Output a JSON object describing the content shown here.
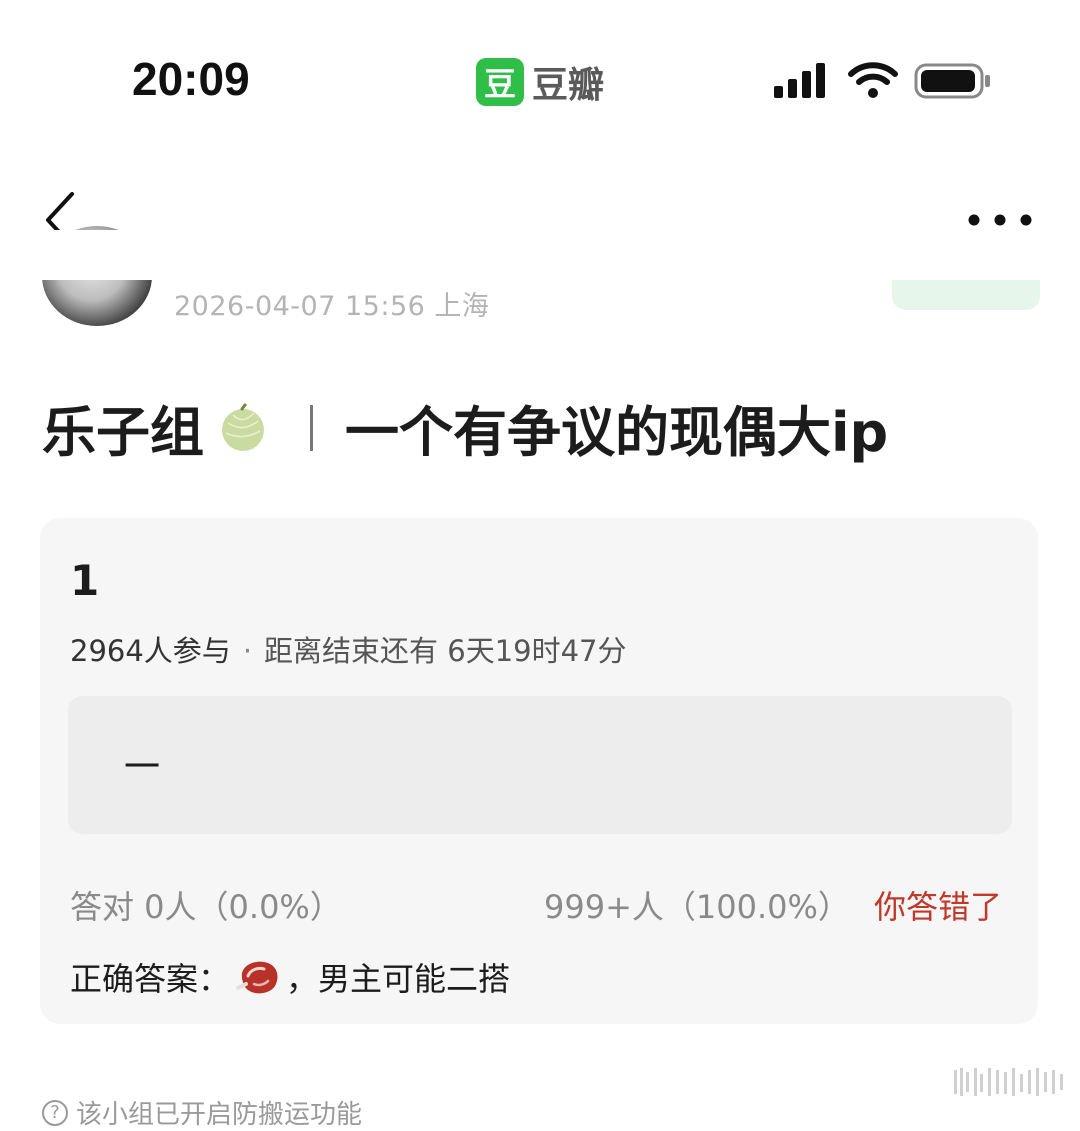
{
  "status_bar": {
    "time": "20:09",
    "app_logo_char": "豆",
    "app_name": "豆瓣"
  },
  "post": {
    "meta": "2026-04-07 15:56  上海",
    "title_prefix": "乐子组",
    "title_main": "一个有争议的现偶大ip"
  },
  "quiz": {
    "number": "1",
    "participants": "2964人参与",
    "separator": "·",
    "deadline": "距离结束还有 6天19时47分",
    "option_label": "一",
    "correct_count": "答对  0人（0.0%）",
    "wrong_count": "999+人（100.0%）",
    "result": "你答错了",
    "answer_label": "正确答案：",
    "answer_text": "，男主可能二搭"
  },
  "footer": {
    "note": "该小组已开启防搬运功能"
  },
  "colors": {
    "brand_green": "#2fbf48",
    "wrong_red": "#c0392b"
  }
}
